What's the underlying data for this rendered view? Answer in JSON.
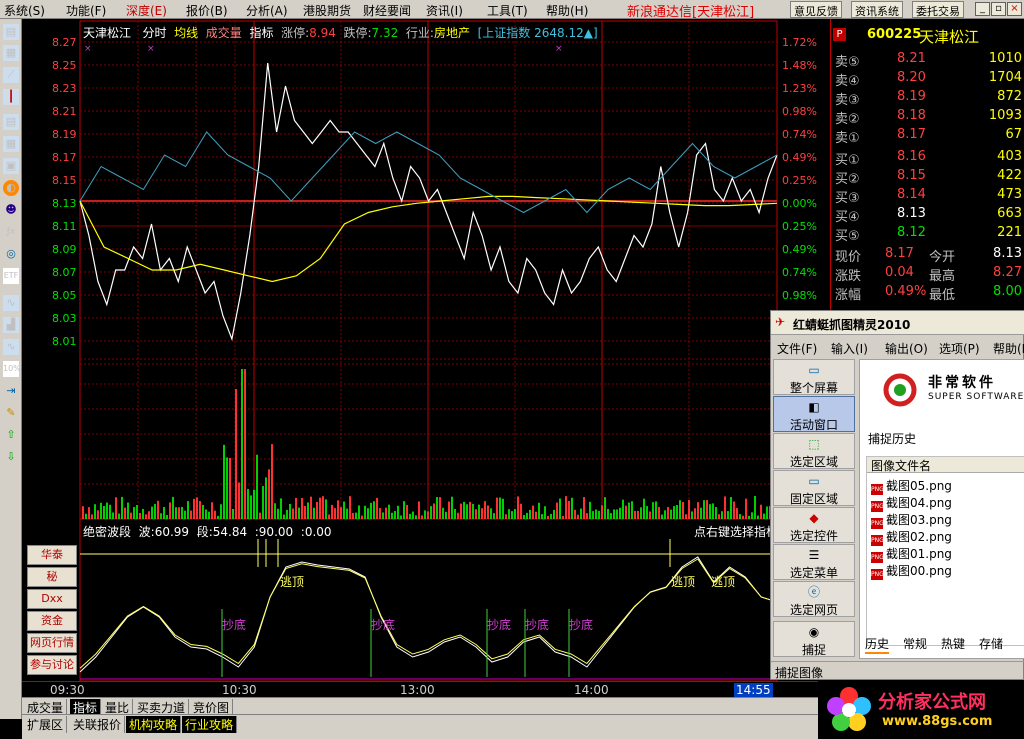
{
  "menu": {
    "items": [
      "系统(S)",
      "功能(F)",
      "深度(E)",
      "报价(B)",
      "分析(A)",
      "港股期货",
      "财经要闻",
      "资讯(I)",
      "工具(T)",
      "帮助(H)"
    ],
    "title": "新浪通达信[天津松江]",
    "buttons": [
      "意见反馈",
      "资讯系统",
      "委托交易"
    ]
  },
  "chart_header": {
    "name": "天津松江",
    "mode": "分时",
    "avg": "均线",
    "vol": "成交量",
    "ind": "指标",
    "limit_up_label": "涨停:",
    "limit_up": "8.94",
    "limit_down_label": "跌停:",
    "limit_down": "7.32",
    "industry_label": "行业:",
    "industry": "房地产",
    "index": "[上证指数",
    "index_value": "2648.12▲]"
  },
  "price_axis": [
    "8.27",
    "8.25",
    "8.23",
    "8.21",
    "8.19",
    "8.17",
    "8.15",
    "8.13",
    "8.11",
    "8.09",
    "8.07",
    "8.05",
    "8.03",
    "8.01"
  ],
  "pct_axis": [
    "1.72%",
    "1.48%",
    "1.23%",
    "0.98%",
    "0.74%",
    "0.49%",
    "0.25%",
    "0.00%",
    "0.25%",
    "0.49%",
    "0.74%",
    "0.98%"
  ],
  "indicator": {
    "title": "绝密波段",
    "bo_label": "波:",
    "bo": "60.99",
    "duan_label": "段:",
    "duan": "54.84",
    "p3": ":90.00",
    "p4": ":0.00",
    "hint": "点右键选择指标"
  },
  "indicator_labels": {
    "buy": [
      "抄底",
      "抄底",
      "抄底",
      "抄底",
      "抄底"
    ],
    "sell": [
      "逃顶",
      "逃顶",
      "逃顶"
    ]
  },
  "side_buttons": [
    "华泰",
    "秘",
    "Dxx",
    "资金",
    "网页行情",
    "参与讨论"
  ],
  "time_axis": [
    "09:30",
    "10:30",
    "13:00",
    "14:00",
    "14:55"
  ],
  "tabs_row1": [
    "成交量",
    "指标",
    "量比",
    "买卖力道",
    "竞价图"
  ],
  "tabs_row2": [
    "扩展区",
    "关联报价",
    "机构攻略",
    "行业攻略"
  ],
  "quote": {
    "code": "600225",
    "name": "天津松江",
    "sells": [
      {
        "label": "卖⑤",
        "price": "8.21",
        "vol": "1010"
      },
      {
        "label": "卖④",
        "price": "8.20",
        "vol": "1704"
      },
      {
        "label": "卖③",
        "price": "8.19",
        "vol": "872"
      },
      {
        "label": "卖②",
        "price": "8.18",
        "vol": "1093"
      },
      {
        "label": "卖①",
        "price": "8.17",
        "vol": "67"
      }
    ],
    "buys": [
      {
        "label": "买①",
        "price": "8.16",
        "vol": "403"
      },
      {
        "label": "买②",
        "price": "8.15",
        "vol": "422"
      },
      {
        "label": "买③",
        "price": "8.14",
        "vol": "473"
      },
      {
        "label": "买④",
        "price": "8.13",
        "vol": "663"
      },
      {
        "label": "买⑤",
        "price": "8.12",
        "vol": "221"
      }
    ],
    "stats": [
      {
        "l1": "现价",
        "v1": "8.17",
        "l2": "今开",
        "v2": "8.13"
      },
      {
        "l1": "涨跌",
        "v1": "0.04",
        "l2": "最高",
        "v2": "8.27"
      },
      {
        "l1": "涨幅",
        "v1": "0.49%",
        "l2": "最低",
        "v2": "8.00"
      }
    ]
  },
  "capture_window": {
    "title": "红蜻蜓抓图精灵2010",
    "menu": [
      "文件(F)",
      "输入(I)",
      "输出(O)",
      "选项(P)",
      "帮助(H)"
    ],
    "tools": [
      "整个屏幕",
      "活动窗口",
      "选定区域",
      "固定区域",
      "选定控件",
      "选定菜单",
      "选定网页"
    ],
    "capture_button": "捕捉",
    "logo_cn": "非常软件",
    "logo_en": "SUPER SOFTWARE",
    "history_label": "捕捉历史",
    "file_header": "图像文件名",
    "files": [
      "截图05.png",
      "截图04.png",
      "截图03.png",
      "截图02.png",
      "截图01.png",
      "截图00.png"
    ],
    "bottom_tabs": [
      "历史",
      "常规",
      "热键",
      "存储"
    ],
    "status": "捕捉图像"
  },
  "brand": {
    "name": "分析家公式网",
    "url": "www.88gs.com"
  },
  "colors": {
    "grid_red": "#c00000",
    "price_line": "#ffffff",
    "avg_line": "#ffff00",
    "index_line": "#40c0e0",
    "up": "#ff4040",
    "down": "#00e000"
  }
}
